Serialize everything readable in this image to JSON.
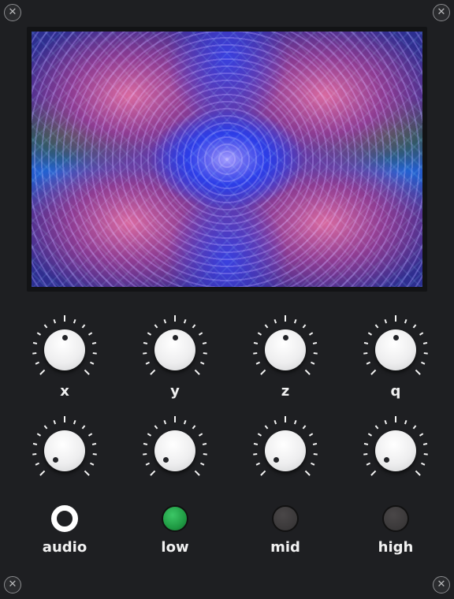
{
  "screws": [
    "close-icon",
    "close-icon",
    "close-icon",
    "close-icon"
  ],
  "screw_glyph": "✕",
  "knobs_row1": [
    {
      "label": "x",
      "value": 0.5
    },
    {
      "label": "y",
      "value": 0.5
    },
    {
      "label": "z",
      "value": 0.5
    },
    {
      "label": "q",
      "value": 0.5
    }
  ],
  "knobs_row2": [
    {
      "value": 0.0
    },
    {
      "value": 0.0
    },
    {
      "value": 0.0
    },
    {
      "value": 0.0
    }
  ],
  "leds": [
    {
      "label": "audio",
      "state": "ring",
      "color": "#ffffff"
    },
    {
      "label": "low",
      "state": "on",
      "color": "#1f9a43"
    },
    {
      "label": "mid",
      "state": "off",
      "color": "#3a3839"
    },
    {
      "label": "high",
      "state": "off",
      "color": "#3a3839"
    }
  ]
}
